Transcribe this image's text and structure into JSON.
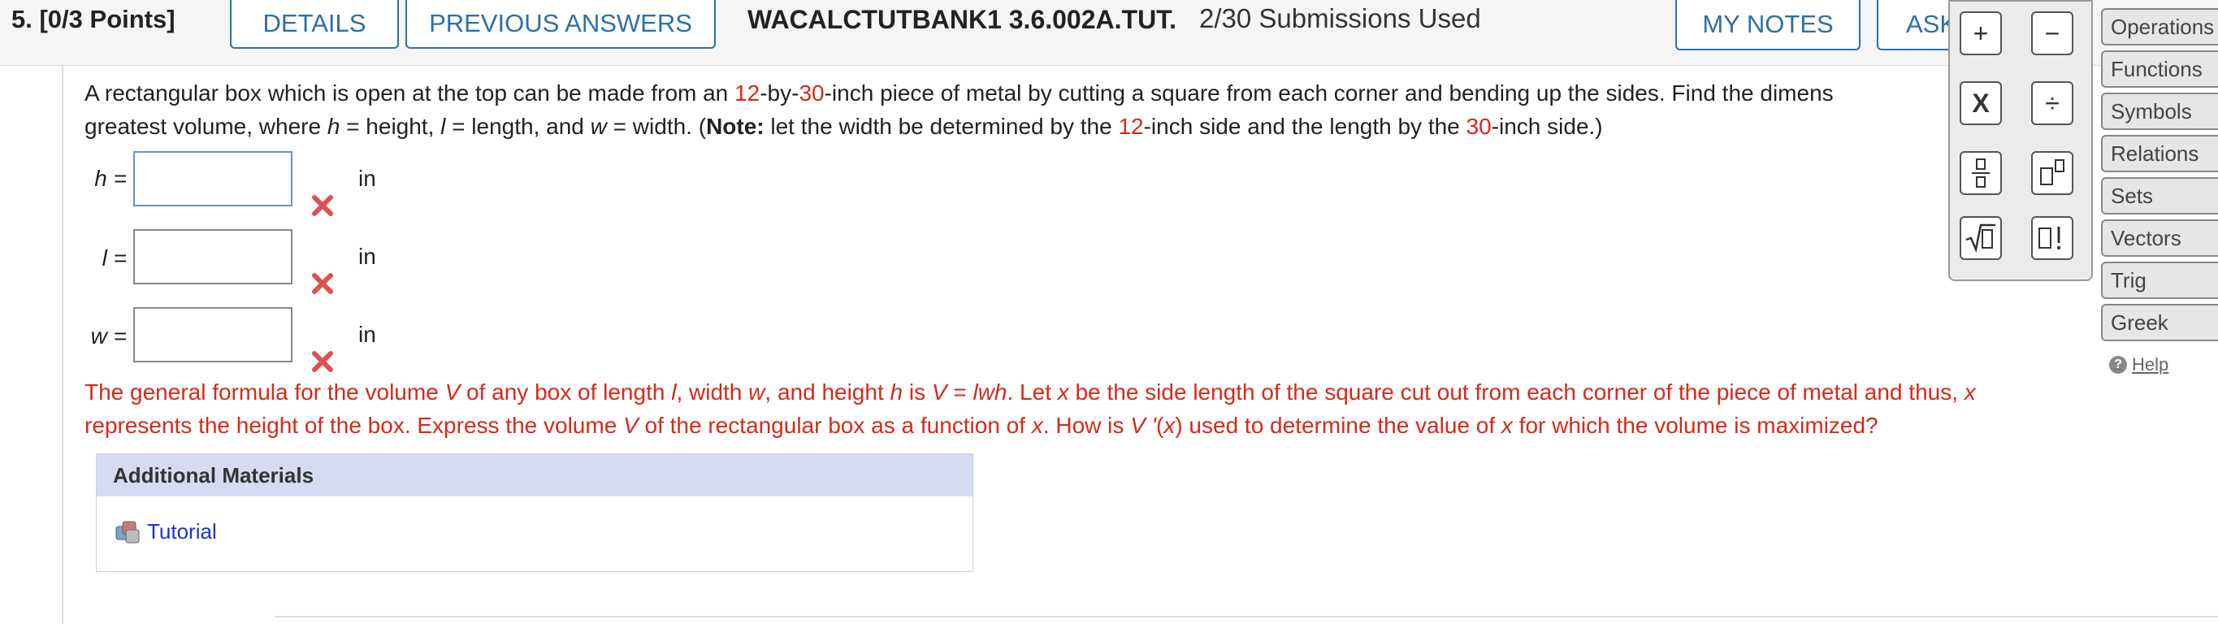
{
  "header": {
    "question_number": "5.",
    "points": "[0/3 Points]",
    "tab_details": "DETAILS",
    "tab_previous_answers": "PREVIOUS ANSWERS",
    "question_code": "WACALCTUTBANK1 3.6.002A.TUT.",
    "submissions": "2/30 Submissions Used",
    "my_notes": "MY NOTES",
    "ask": "ASK"
  },
  "question": {
    "p1_a": "A rectangular box which is open at the top can be made from an ",
    "n12": "12",
    "dash1": "-by-",
    "n30": "30",
    "p1_b": "-inch piece of metal by cutting a square from each corner and bending up the sides. Find the dimens",
    "p2_a": "greatest volume, where ",
    "h": "h",
    "p2_b": " = height, ",
    "l": "l",
    "p2_c": " = length, and ",
    "w": "w",
    "p2_d": " = width. (",
    "note": "Note:",
    "p2_e": " let the width be determined by the ",
    "n12b": "12",
    "p2_f": "-inch side and the length by the ",
    "n30b": "30",
    "p2_g": "-inch side.)"
  },
  "answers": [
    {
      "label": "h =",
      "value": "",
      "unit": "in"
    },
    {
      "label": "l =",
      "value": "",
      "unit": "in"
    },
    {
      "label": "w =",
      "value": "",
      "unit": "in"
    }
  ],
  "hint": {
    "a": "The general formula for the volume ",
    "V": "V",
    "b": " of any box of length ",
    "l": "l",
    "c": ", width ",
    "w": "w",
    "d": ", and height ",
    "h": "h",
    "e": " is ",
    "V2": "V",
    "f": " = ",
    "lwh": "lwh",
    "g": ". Let ",
    "x": "x",
    "h2": " be the side length of the square cut out from each corner of the piece of metal and thus, ",
    "x2": "x",
    "line2_a": "represents the height of the box. Express the volume ",
    "V3": "V",
    "line2_b": " of the rectangular box as a function of ",
    "x3": "x",
    "line2_c": ". How is ",
    "Vp": "V '",
    "line2_d": "(",
    "x4": "x",
    "line2_e": ") used to determine the value of ",
    "x5": "x",
    "line2_f": " for which the volume is maximized?"
  },
  "additional_materials": {
    "title": "Additional Materials",
    "tutorial": "Tutorial"
  },
  "palette": {
    "plus": "+",
    "minus": "−",
    "times": "X",
    "divide": "÷",
    "fraction": "▯/▯",
    "power": "▯▯",
    "sqrt": "√▯",
    "factorial": "▯!"
  },
  "categories": [
    "Operations",
    "Functions",
    "Symbols",
    "Relations",
    "Sets",
    "Vectors",
    "Trig",
    "Greek"
  ],
  "help_label": "Help",
  "colors": {
    "accent": "#2f6fa7",
    "error": "#d6291b",
    "link": "#1a33c8",
    "panel_head": "#d6daf3"
  }
}
